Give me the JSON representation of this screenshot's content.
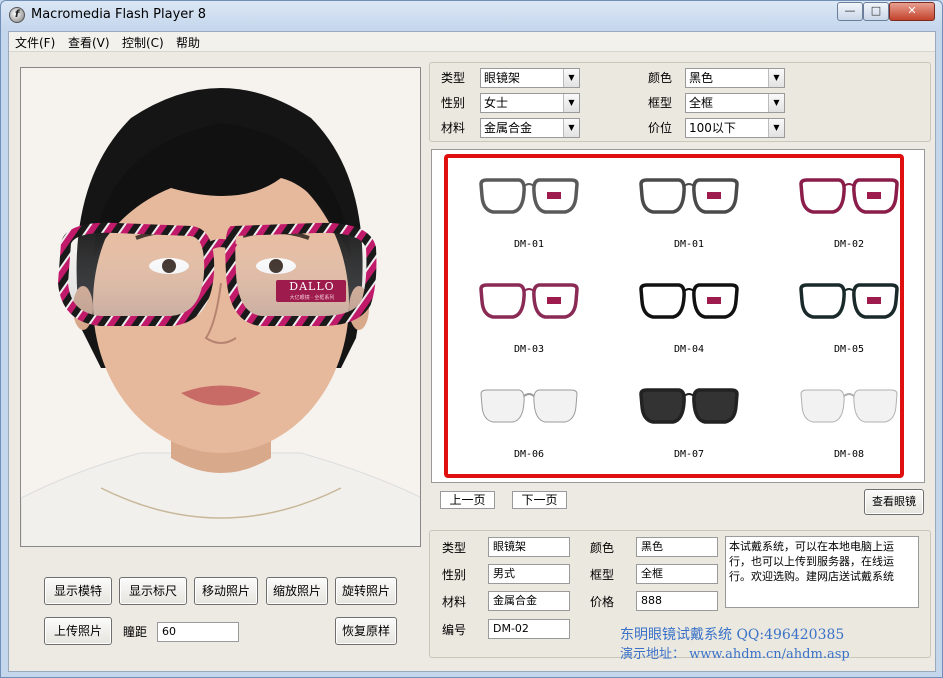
{
  "window": {
    "title": "Macromedia Flash Player 8",
    "min": "—",
    "max": "□",
    "close": "✕"
  },
  "menu": [
    "文件(F)",
    "查看(V)",
    "控制(C)",
    "帮助"
  ],
  "photo": {
    "glasses_brand": "DALLO",
    "glasses_sub": "大亿眼镜 · 全框系列"
  },
  "filters": {
    "type_label": "类型",
    "type_value": "眼镜架",
    "gender_label": "性别",
    "gender_value": "女士",
    "material_label": "材料",
    "material_value": "金属合金",
    "color_label": "颜色",
    "color_value": "黑色",
    "frame_label": "框型",
    "frame_value": "全框",
    "price_label": "价位",
    "price_value": "100以下"
  },
  "gallery": [
    {
      "code": "DM-01",
      "color": "#5a5a5a",
      "style": "full"
    },
    {
      "code": "DM-01",
      "color": "#4a4a4a",
      "style": "full"
    },
    {
      "code": "DM-02",
      "color": "#8a1d4a",
      "style": "full"
    },
    {
      "code": "DM-03",
      "color": "#8a2a55",
      "style": "full"
    },
    {
      "code": "DM-04",
      "color": "#111111",
      "style": "full"
    },
    {
      "code": "DM-05",
      "color": "#1a2a2a",
      "style": "full"
    },
    {
      "code": "DM-06",
      "color": "#9a9a9a",
      "style": "rimless"
    },
    {
      "code": "DM-07",
      "color": "#222222",
      "style": "sun"
    },
    {
      "code": "DM-08",
      "color": "#b0b0b0",
      "style": "rimless"
    }
  ],
  "pager": {
    "prev": "上一页",
    "next": "下一页",
    "view": "查看眼镜"
  },
  "tools": {
    "show_model": "显示模特",
    "show_ruler": "显示标尺",
    "move_photo": "移动照片",
    "zoom_photo": "缩放照片",
    "rotate_photo": "旋转照片",
    "upload_photo": "上传照片",
    "pd_label": "瞳距",
    "pd_value": "60",
    "restore": "恢复原样"
  },
  "detail": {
    "type_label": "类型",
    "type_value": "眼镜架",
    "gender_label": "性别",
    "gender_value": "男式",
    "material_label": "材料",
    "material_value": "金属合金",
    "code_label": "编号",
    "code_value": "DM-02",
    "color_label": "颜色",
    "color_value": "黑色",
    "frame_label": "框型",
    "frame_value": "全框",
    "price_label": "价格",
    "price_value": "888",
    "desc": "本试戴系统，可以在本地电脑上运行，也可以上传到服务器，在线运行。欢迎选购。建网店送试戴系统"
  },
  "footer": {
    "line1": "东明眼镜试戴系统 QQ:496420385",
    "line2": "演示地址：  www.ahdm.cn/ahdm.asp"
  }
}
